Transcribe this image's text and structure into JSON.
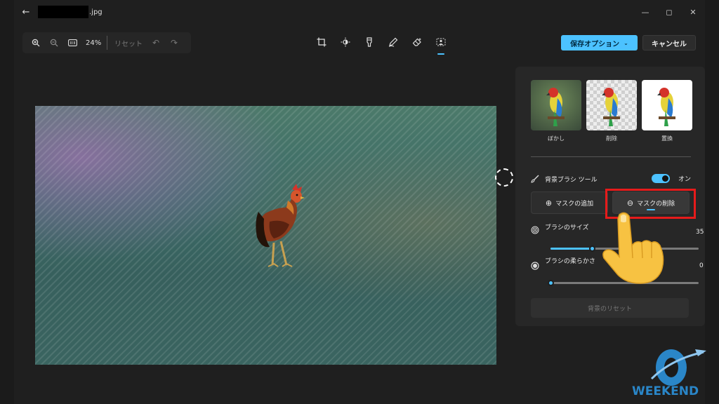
{
  "titlebar": {
    "filename": ".jpg"
  },
  "toolbar": {
    "zoom": "24%",
    "reset_label": "リセット"
  },
  "header": {
    "save_label": "保存オプション",
    "cancel_label": "キャンセル"
  },
  "panel": {
    "thumbs": [
      {
        "label": "ぼかし"
      },
      {
        "label": "削除"
      },
      {
        "label": "置換"
      }
    ],
    "brush_tool_label": "背景ブラシ ツール",
    "toggle_label": "オン",
    "mask_add_label": "マスクの追加",
    "mask_remove_label": "マスクの削除",
    "brush_size_label": "ブラシのサイズ",
    "brush_size_value": "35",
    "brush_size_fraction": 0.28,
    "brush_soft_label": "ブラシの柔らかさ",
    "brush_soft_value": "0",
    "brush_soft_fraction": 0,
    "reset_bg_label": "背景のリセット"
  },
  "colors": {
    "accent": "#4cc2ff",
    "highlight": "#e61b1b"
  },
  "watermark": {
    "text": "WEEKEND"
  }
}
